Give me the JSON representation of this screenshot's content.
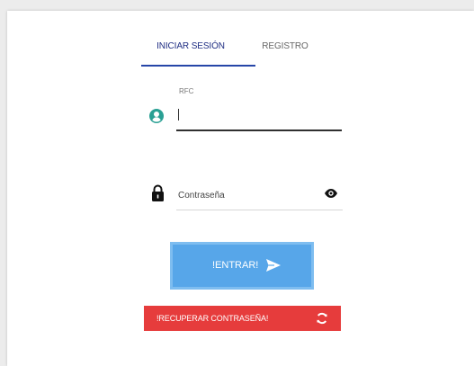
{
  "tabs": {
    "login_label": "INICIAR SESIÓN",
    "register_label": "REGISTRO"
  },
  "rfc_field": {
    "label": "RFC",
    "value": "",
    "icon": "user-circle-icon"
  },
  "password_field": {
    "placeholder": "Contraseña",
    "value": "",
    "icon": "lock-icon",
    "toggle_icon": "eye-icon"
  },
  "buttons": {
    "enter_label": "!ENTRAR!",
    "enter_icon": "send-icon",
    "recover_label": "!RECUPERAR CONTRASEÑA!",
    "recover_icon": "refresh-icon"
  },
  "colors": {
    "active_tab": "#1f2e83",
    "tab_indicator": "#2646a8",
    "user_icon": "#2aa094",
    "enter_button": "#57a6e9",
    "recover_button": "#e63c3c"
  }
}
